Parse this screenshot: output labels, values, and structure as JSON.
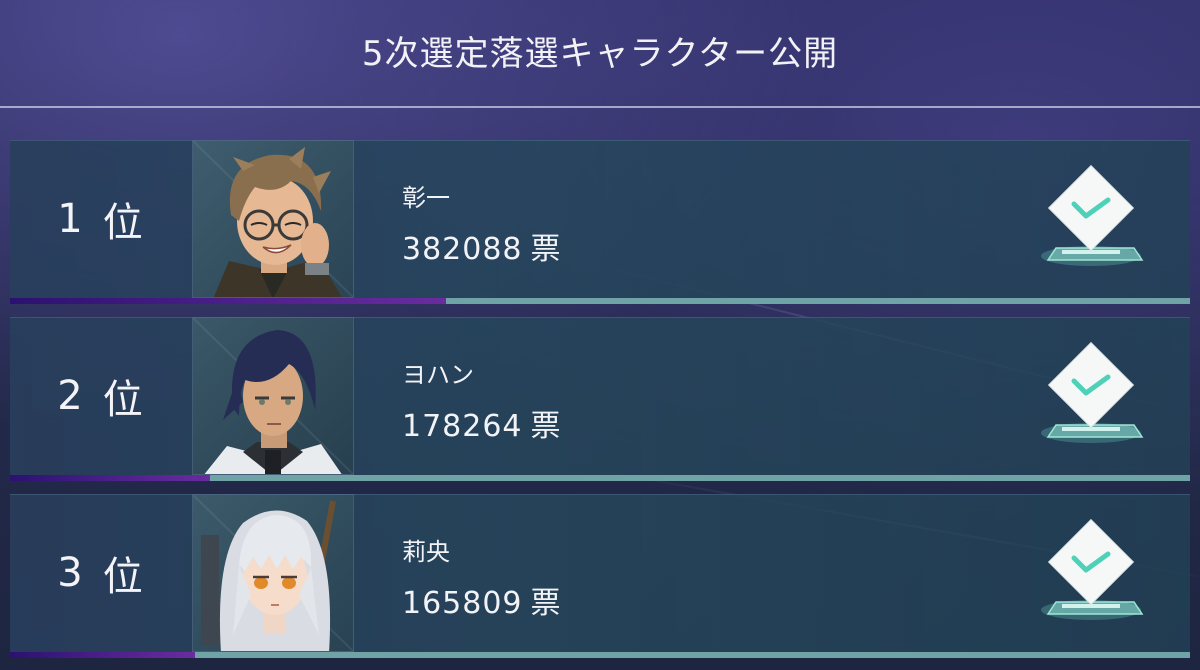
{
  "header": {
    "title": "5次選定落選キャラクター公開"
  },
  "rankings": [
    {
      "rank_number": "1",
      "rank_suffix": "位",
      "name": "彰一",
      "votes": "382088",
      "votes_unit": "票",
      "vote_share_bar": 0.3695,
      "portrait": "glasses-brown-hair-man-portrait"
    },
    {
      "rank_number": "2",
      "rank_suffix": "位",
      "name": "ヨハン",
      "votes": "178264",
      "votes_unit": "票",
      "vote_share_bar": 0.1695,
      "portrait": "dark-hair-man-portrait"
    },
    {
      "rank_number": "3",
      "rank_suffix": "位",
      "name": "莉央",
      "votes": "165809",
      "votes_unit": "票",
      "vote_share_bar": 0.1568,
      "portrait": "white-hair-girl-portrait"
    }
  ],
  "icons": {
    "vote": "ballot-box-check-icon"
  },
  "colors": {
    "accent_check": "#4fd1b8",
    "bar_fill": "#5a2590",
    "bar_track": "#6fa3a6"
  }
}
